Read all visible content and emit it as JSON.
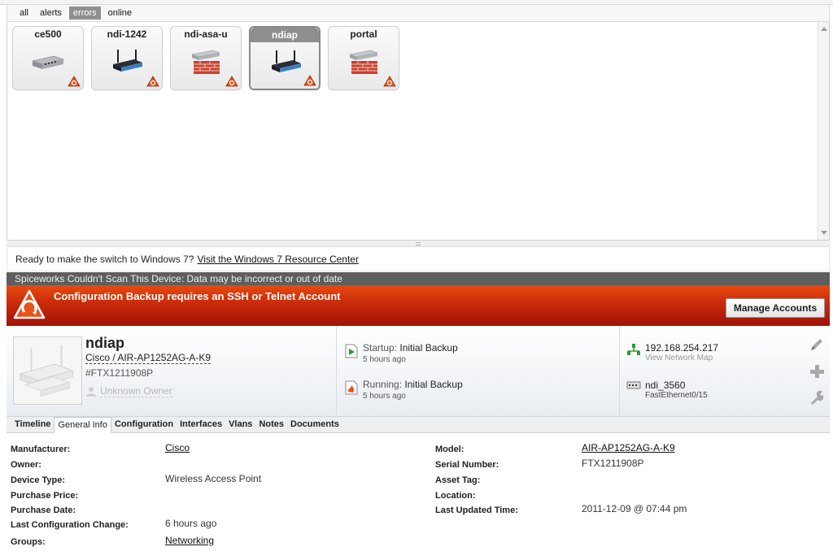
{
  "filters": [
    "all",
    "alerts",
    "errors",
    "online"
  ],
  "active_filter": "errors",
  "devices": [
    {
      "name": "ce500",
      "kind": "switch"
    },
    {
      "name": "ndi-1242",
      "kind": "access-point"
    },
    {
      "name": "ndi-asa-u",
      "kind": "firewall"
    },
    {
      "name": "ndiap",
      "kind": "access-point"
    },
    {
      "name": "portal",
      "kind": "firewall"
    }
  ],
  "selected_device": "ndiap",
  "notice": {
    "text": "Ready to make the switch to Windows 7?",
    "link": "Visit the Windows 7 Resource Center"
  },
  "scan_warning": "Spiceworks Couldn't Scan This Device: Data may be incorrect or out of date",
  "banner": {
    "message": "Configuration Backup requires an SSH or Telnet Account",
    "button": "Manage Accounts",
    "color": "#c82a0a"
  },
  "device": {
    "name": "ndiap",
    "model": "Cisco / AIR-AP1252AG-A-K9",
    "serial": "#FTX1211908P",
    "owner": "Unknown Owner"
  },
  "config": {
    "startup_label": "Startup:",
    "startup_value": "Initial Backup",
    "startup_time": "5 hours ago",
    "running_label": "Running:",
    "running_value": "Initial Backup",
    "running_time": "5 hours ago"
  },
  "network": {
    "ip": "192.168.254.217",
    "map_link": "View Network Map",
    "switch": "ndi_3560",
    "port": "FastEthernet0/15"
  },
  "tabs": [
    "Timeline",
    "General Info",
    "Configuration",
    "Interfaces",
    "Vlans",
    "Notes",
    "Documents"
  ],
  "active_tab": "General Info",
  "general_info": {
    "left": [
      {
        "label": "Manufacturer:",
        "value": "Cisco",
        "link": true
      },
      {
        "label": "Owner:",
        "value": "",
        "link": false
      },
      {
        "label": "Device Type:",
        "value": "Wireless Access Point",
        "link": false
      },
      {
        "label": "Purchase Price:",
        "value": "",
        "link": false
      },
      {
        "label": "Purchase Date:",
        "value": "",
        "link": false
      },
      {
        "label": "Last Configuration Change:",
        "value": "6 hours ago",
        "link": false
      },
      {
        "label": "Groups:",
        "value": "Networking",
        "link": true
      }
    ],
    "right": [
      {
        "label": "Model:",
        "value": "AIR-AP1252AG-A-K9",
        "link": true
      },
      {
        "label": "Serial Number:",
        "value": "FTX1211908P",
        "link": false
      },
      {
        "label": "Asset Tag:",
        "value": "",
        "link": false
      },
      {
        "label": "Location:",
        "value": "",
        "link": false
      },
      {
        "label": "Last Updated Time:",
        "value": "2011-12-09 @ 07:44 pm",
        "link": false
      }
    ]
  }
}
